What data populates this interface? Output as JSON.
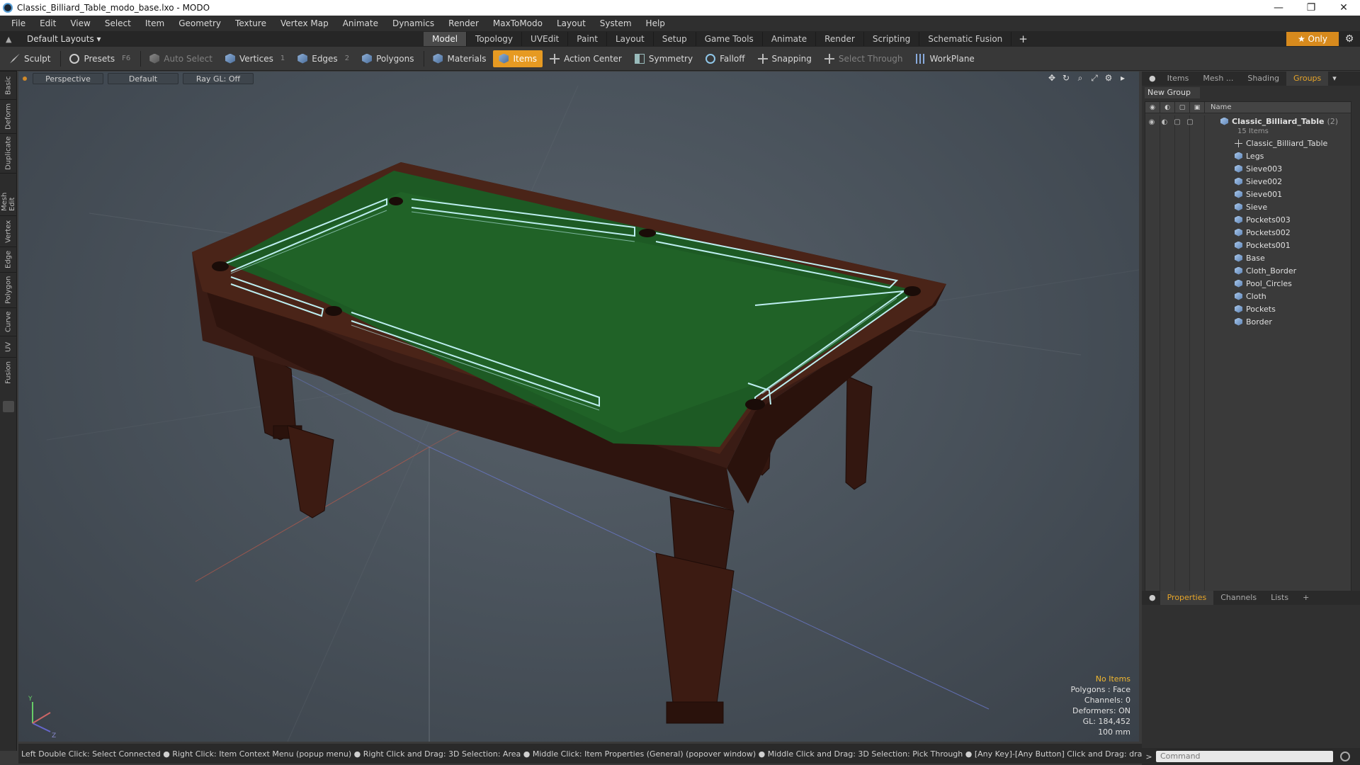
{
  "window": {
    "title": "Classic_Billiard_Table_modo_base.lxo - MODO",
    "controls": [
      "—",
      "❐",
      "✕"
    ]
  },
  "menu": [
    "File",
    "Edit",
    "View",
    "Select",
    "Item",
    "Geometry",
    "Texture",
    "Vertex Map",
    "Animate",
    "Dynamics",
    "Render",
    "MaxToModo",
    "Layout",
    "System",
    "Help"
  ],
  "layout_bar": {
    "layout_name": "Default Layouts ▾",
    "tabs": [
      "Model",
      "Topology",
      "UVEdit",
      "Paint",
      "Layout",
      "Setup",
      "Game Tools",
      "Animate",
      "Render",
      "Scripting",
      "Schematic Fusion"
    ],
    "active_tab": "Model",
    "add": "+",
    "only_label": "★  Only"
  },
  "toolbar": {
    "sculpt": "Sculpt",
    "presets": "Presets",
    "presets_key": "F6",
    "auto_select": "Auto Select",
    "vertices": "Vertices",
    "vertices_key": "1",
    "edges": "Edges",
    "edges_key": "2",
    "polygons": "Polygons",
    "materials": "Materials",
    "items": "Items",
    "action_center": "Action Center",
    "symmetry": "Symmetry",
    "falloff": "Falloff",
    "snapping": "Snapping",
    "select_through": "Select Through",
    "workplane": "WorkPlane"
  },
  "left_tabs": [
    "Basic",
    "Deform",
    "Duplicate",
    "Mesh Edit",
    "Vertex",
    "Edge",
    "Polygon",
    "Curve",
    "UV",
    "Fusion"
  ],
  "viewport": {
    "view": "Perspective",
    "shading": "Default",
    "raygl": "Ray GL: Off",
    "info": {
      "no_items": "No Items",
      "polygons": "Polygons : Face",
      "channels": "Channels: 0",
      "deformers": "Deformers: ON",
      "gl": "GL: 184,452",
      "scale": "100 mm"
    },
    "axis_labels": {
      "y": "Y",
      "z": "Z"
    }
  },
  "statusbar": "Left Double Click: Select Connected ● Right Click: Item Context Menu (popup menu) ● Right Click and Drag: 3D Selection: Area ● Middle Click: Item Properties (General) (popover window) ● Middle Click and Drag: 3D Selection: Pick Through ● [Any Key]-[Any Button] Click and Drag: dragDropBegin",
  "right_panel": {
    "tabs": [
      "Items",
      "Mesh ...",
      "Shading",
      "Groups"
    ],
    "active_tab": "Groups",
    "new_group": "New Group",
    "column_name": "Name",
    "group_name": "Classic_Billiard_Table",
    "group_count": "(2)",
    "group_sub": "15 Items",
    "items": [
      "Classic_Billiard_Table",
      "Legs",
      "Sieve003",
      "Sieve002",
      "Sieve001",
      "Sieve",
      "Pockets003",
      "Pockets002",
      "Pockets001",
      "Base",
      "Cloth_Border",
      "Pool_Circles",
      "Cloth",
      "Pockets",
      "Border"
    ],
    "bottom_tabs": [
      "Properties",
      "Channels",
      "Lists",
      "+"
    ],
    "bottom_active": "Properties",
    "command_placeholder": "Command"
  },
  "colors": {
    "accent": "#e69a22",
    "felt": "#1d5a24",
    "wood": "#3a1c15",
    "wire": "#bdeef0"
  }
}
